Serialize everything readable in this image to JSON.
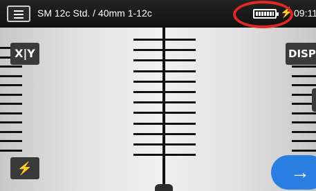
{
  "header": {
    "title": "SM 12c Std. / 40mm 1-12c",
    "clock": "09:11"
  },
  "battery": {
    "status_icon": "battery-full-icon",
    "charging_icon": "charging-bolt-icon",
    "highlight_color": "#e32727",
    "charge_symbol": "⚡"
  },
  "buttons": {
    "xy_label": "X|Y",
    "disp_label": "DISP",
    "flash_symbol": "⚡",
    "next_symbol": "→"
  },
  "colors": {
    "accent": "#2a7de1",
    "topbar": "#111111",
    "fiber": "#111111"
  },
  "fibers": {
    "left_count": 12,
    "center_count": 12,
    "right_count": 12
  }
}
